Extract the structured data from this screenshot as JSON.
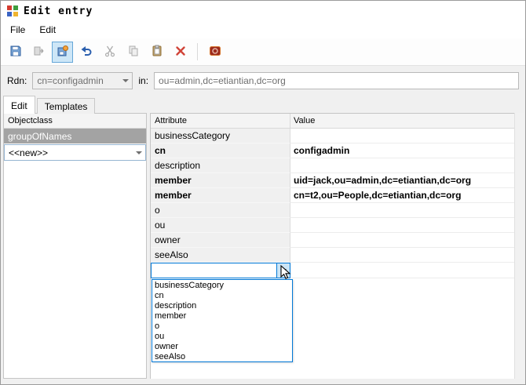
{
  "window": {
    "title": "Edit entry"
  },
  "menu": {
    "items": [
      "File",
      "Edit"
    ]
  },
  "toolbar": {
    "buttons": [
      "save",
      "rename-entry",
      "apply-template",
      "undo",
      "cut",
      "copy",
      "paste",
      "delete",
      "exit"
    ]
  },
  "form": {
    "rdn_label": "Rdn:",
    "rdn_value": "cn=configadmin",
    "in_label": "in:",
    "in_value": "ou=admin,dc=etiantian,dc=org"
  },
  "tabs": {
    "edit": "Edit",
    "templates": "Templates"
  },
  "objectclass": {
    "header": "Objectclass",
    "selected_item": "groupOfNames",
    "new_item": "<<new>>"
  },
  "attributes": {
    "headers": {
      "attribute": "Attribute",
      "value": "Value"
    },
    "rows": [
      {
        "attribute": "businessCategory",
        "value": "",
        "bold": false
      },
      {
        "attribute": "cn",
        "value": "configadmin",
        "bold": true
      },
      {
        "attribute": "description",
        "value": "",
        "bold": false
      },
      {
        "attribute": "member",
        "value": "uid=jack,ou=admin,dc=etiantian,dc=org",
        "bold": true
      },
      {
        "attribute": "member",
        "value": "cn=t2,ou=People,dc=etiantian,dc=org",
        "bold": true
      },
      {
        "attribute": "o",
        "value": "",
        "bold": false
      },
      {
        "attribute": "ou",
        "value": "",
        "bold": false
      },
      {
        "attribute": "owner",
        "value": "",
        "bold": false
      },
      {
        "attribute": "seeAlso",
        "value": "",
        "bold": false
      }
    ],
    "new_attribute_combo": {
      "value": "",
      "options": [
        "businessCategory",
        "cn",
        "description",
        "member",
        "o",
        "ou",
        "owner",
        "seeAlso"
      ]
    }
  }
}
